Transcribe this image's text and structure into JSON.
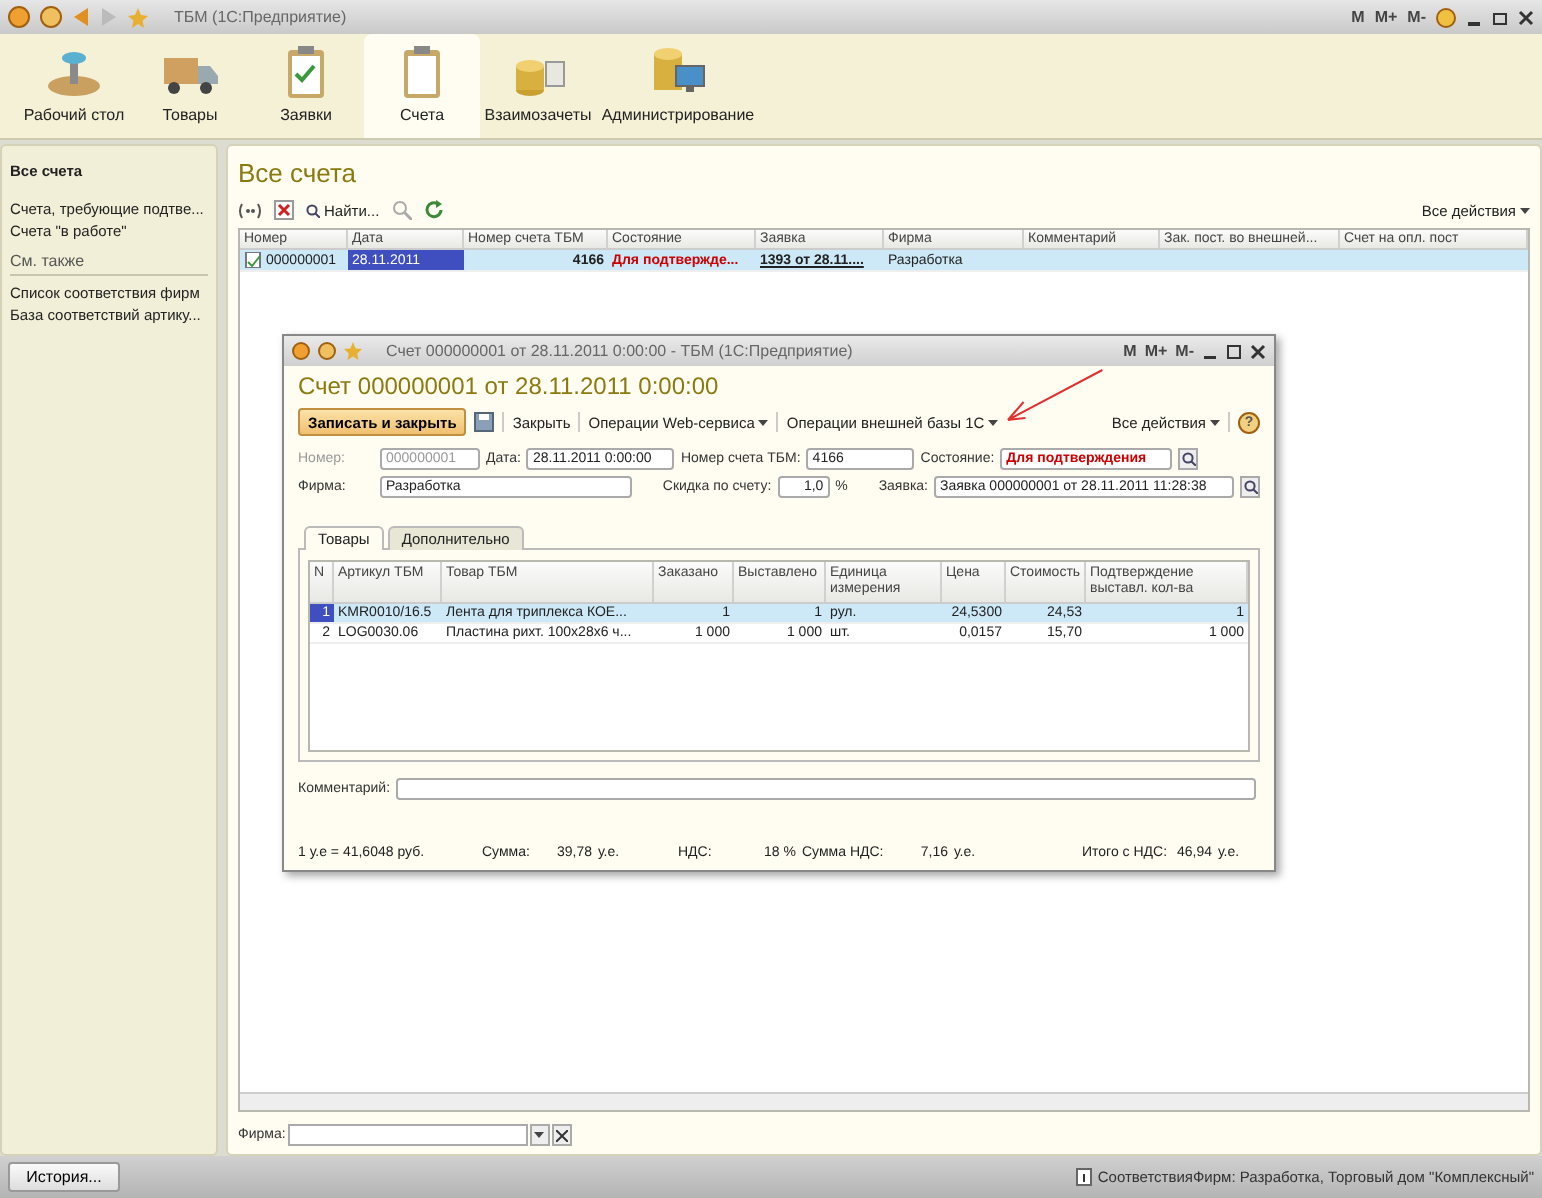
{
  "window": {
    "title": "ТБМ  (1С:Предприятие)",
    "memory_buttons": [
      "M",
      "M+",
      "M-"
    ]
  },
  "sections": [
    {
      "label": "Рабочий стол",
      "selected": false
    },
    {
      "label": "Товары",
      "selected": false
    },
    {
      "label": "Заявки",
      "selected": false
    },
    {
      "label": "Счета",
      "selected": true
    },
    {
      "label": "Взаимозачеты",
      "selected": false
    },
    {
      "label": "Администрирование",
      "selected": false
    }
  ],
  "nav": {
    "items": [
      {
        "label": "Все счета",
        "selected": true
      },
      {
        "label": "Счета, требующие подтве...",
        "selected": false
      },
      {
        "label": "Счета \"в работе\"",
        "selected": false
      }
    ],
    "see_also_title": "См. также",
    "see_also": [
      "Список соответствия фирм",
      "База соответствий артику..."
    ]
  },
  "list": {
    "title": "Все счета",
    "find": "Найти...",
    "all_actions": "Все действия",
    "columns": [
      {
        "label": "Номер",
        "kind": "text"
      },
      {
        "label": "Дата",
        "kind": "text"
      },
      {
        "label": "Номер счета ТБМ",
        "kind": "number"
      },
      {
        "label": "Состояние",
        "kind": "alert"
      },
      {
        "label": "Заявка",
        "kind": "link"
      },
      {
        "label": "Фирма",
        "kind": "text"
      },
      {
        "label": "Комментарий",
        "kind": "text"
      },
      {
        "label": "Зак. пост. во внешней...",
        "kind": "text"
      },
      {
        "label": "Счет на опл. пост",
        "kind": "text"
      }
    ],
    "rows": [
      {
        "selected": true,
        "cells": [
          "000000001",
          "28.11.2011",
          "4166",
          "Для подтвержде...",
          "1393 от 28.11....",
          "Разработка"
        ]
      }
    ]
  },
  "filter": {
    "label": "Фирма:"
  },
  "dialog": {
    "title": "Счет 000000001 от 28.11.2011 0:00:00 - ТБМ  (1С:Предприятие)",
    "memory_buttons": [
      "M",
      "M+",
      "M-"
    ],
    "heading": "Счет 000000001 от 28.11.2011 0:00:00",
    "save_close": "Записать и закрыть",
    "close": "Закрыть",
    "menus": [
      "Операции Web-сервиса",
      "Операции внешней базы 1С"
    ],
    "all_actions": "Все действия",
    "help": "?",
    "fields_row1": [
      {
        "label": "Номер:",
        "value": "000000001",
        "disabled": true,
        "alert": false
      },
      {
        "label": "Дата:",
        "value": "28.11.2011  0:00:00",
        "disabled": false,
        "alert": false
      },
      {
        "label": "Номер счета ТБМ:",
        "value": "4166",
        "disabled": false,
        "alert": false
      },
      {
        "label": "Состояние:",
        "value": "Для подтверждения",
        "disabled": false,
        "alert": true
      }
    ],
    "firm": {
      "label": "Фирма:",
      "value": "Разработка"
    },
    "discount": {
      "label": "Скидка по счету:",
      "value": "1,0",
      "unit": "%"
    },
    "request": {
      "label": "Заявка:",
      "value": "Заявка 000000001 от 28.11.2011 11:28:38"
    },
    "tabs": [
      {
        "label": "Товары",
        "selected": true
      },
      {
        "label": "Дополнительно",
        "selected": false
      }
    ],
    "columns": [
      {
        "label": "N",
        "kind": "number"
      },
      {
        "label": "Артикул ТБМ",
        "kind": "text"
      },
      {
        "label": "Товар ТБМ",
        "kind": "text"
      },
      {
        "label": "Заказано",
        "kind": "number"
      },
      {
        "label": "Выставлено",
        "kind": "number"
      },
      {
        "label": "Единица измерения",
        "kind": "text"
      },
      {
        "label": "Цена",
        "kind": "number"
      },
      {
        "label": "Стоимость",
        "kind": "number"
      },
      {
        "label": "Подтверждение выставл. кол-ва",
        "kind": "number"
      }
    ],
    "rows": [
      {
        "selected": true,
        "cells": [
          "1",
          "KMR0010/16.5",
          "Лента для триплекса КОЕ...",
          "1",
          "1",
          "рул.",
          "24,5300",
          "24,53",
          "1"
        ]
      },
      {
        "selected": false,
        "cells": [
          "2",
          "LOG0030.06",
          "Пластина рихт. 100х28х6 ч...",
          "1 000",
          "1 000",
          "шт.",
          "0,0157",
          "15,70",
          "1 000"
        ]
      }
    ],
    "comment_label": "Комментарий:",
    "rate": "1 у.е = 41,6048 руб.",
    "totals": [
      {
        "label": "Сумма:",
        "value": "39,78",
        "unit": "у.е."
      },
      {
        "label": "НДС:",
        "value": "18 %"
      },
      {
        "label": "Сумма НДС:",
        "value": "7,16",
        "unit": "у.е."
      },
      {
        "label": "Итого с НДС:",
        "value": "46,94",
        "unit": "у.е."
      }
    ]
  },
  "taskbar": {
    "history": "История...",
    "status": "СоответствияФирм: Разработка, Торговый дом \"Комплексный\""
  }
}
